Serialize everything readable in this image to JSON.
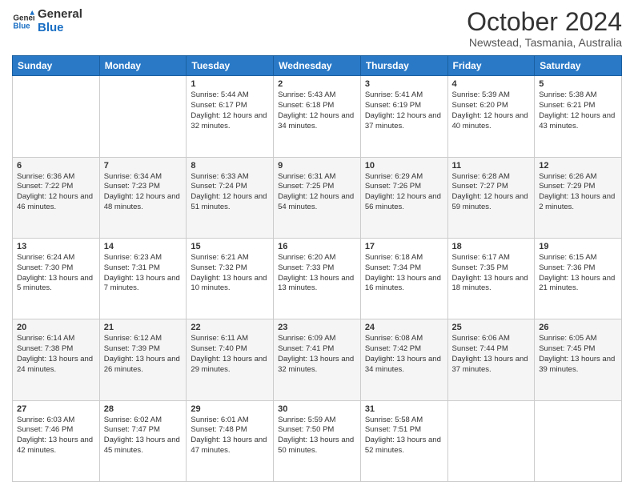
{
  "header": {
    "logo_line1": "General",
    "logo_line2": "Blue",
    "title": "October 2024",
    "subtitle": "Newstead, Tasmania, Australia"
  },
  "weekdays": [
    "Sunday",
    "Monday",
    "Tuesday",
    "Wednesday",
    "Thursday",
    "Friday",
    "Saturday"
  ],
  "weeks": [
    [
      {
        "day": "",
        "info": ""
      },
      {
        "day": "",
        "info": ""
      },
      {
        "day": "1",
        "info": "Sunrise: 5:44 AM\nSunset: 6:17 PM\nDaylight: 12 hours and 32 minutes."
      },
      {
        "day": "2",
        "info": "Sunrise: 5:43 AM\nSunset: 6:18 PM\nDaylight: 12 hours and 34 minutes."
      },
      {
        "day": "3",
        "info": "Sunrise: 5:41 AM\nSunset: 6:19 PM\nDaylight: 12 hours and 37 minutes."
      },
      {
        "day": "4",
        "info": "Sunrise: 5:39 AM\nSunset: 6:20 PM\nDaylight: 12 hours and 40 minutes."
      },
      {
        "day": "5",
        "info": "Sunrise: 5:38 AM\nSunset: 6:21 PM\nDaylight: 12 hours and 43 minutes."
      }
    ],
    [
      {
        "day": "6",
        "info": "Sunrise: 6:36 AM\nSunset: 7:22 PM\nDaylight: 12 hours and 46 minutes."
      },
      {
        "day": "7",
        "info": "Sunrise: 6:34 AM\nSunset: 7:23 PM\nDaylight: 12 hours and 48 minutes."
      },
      {
        "day": "8",
        "info": "Sunrise: 6:33 AM\nSunset: 7:24 PM\nDaylight: 12 hours and 51 minutes."
      },
      {
        "day": "9",
        "info": "Sunrise: 6:31 AM\nSunset: 7:25 PM\nDaylight: 12 hours and 54 minutes."
      },
      {
        "day": "10",
        "info": "Sunrise: 6:29 AM\nSunset: 7:26 PM\nDaylight: 12 hours and 56 minutes."
      },
      {
        "day": "11",
        "info": "Sunrise: 6:28 AM\nSunset: 7:27 PM\nDaylight: 12 hours and 59 minutes."
      },
      {
        "day": "12",
        "info": "Sunrise: 6:26 AM\nSunset: 7:29 PM\nDaylight: 13 hours and 2 minutes."
      }
    ],
    [
      {
        "day": "13",
        "info": "Sunrise: 6:24 AM\nSunset: 7:30 PM\nDaylight: 13 hours and 5 minutes."
      },
      {
        "day": "14",
        "info": "Sunrise: 6:23 AM\nSunset: 7:31 PM\nDaylight: 13 hours and 7 minutes."
      },
      {
        "day": "15",
        "info": "Sunrise: 6:21 AM\nSunset: 7:32 PM\nDaylight: 13 hours and 10 minutes."
      },
      {
        "day": "16",
        "info": "Sunrise: 6:20 AM\nSunset: 7:33 PM\nDaylight: 13 hours and 13 minutes."
      },
      {
        "day": "17",
        "info": "Sunrise: 6:18 AM\nSunset: 7:34 PM\nDaylight: 13 hours and 16 minutes."
      },
      {
        "day": "18",
        "info": "Sunrise: 6:17 AM\nSunset: 7:35 PM\nDaylight: 13 hours and 18 minutes."
      },
      {
        "day": "19",
        "info": "Sunrise: 6:15 AM\nSunset: 7:36 PM\nDaylight: 13 hours and 21 minutes."
      }
    ],
    [
      {
        "day": "20",
        "info": "Sunrise: 6:14 AM\nSunset: 7:38 PM\nDaylight: 13 hours and 24 minutes."
      },
      {
        "day": "21",
        "info": "Sunrise: 6:12 AM\nSunset: 7:39 PM\nDaylight: 13 hours and 26 minutes."
      },
      {
        "day": "22",
        "info": "Sunrise: 6:11 AM\nSunset: 7:40 PM\nDaylight: 13 hours and 29 minutes."
      },
      {
        "day": "23",
        "info": "Sunrise: 6:09 AM\nSunset: 7:41 PM\nDaylight: 13 hours and 32 minutes."
      },
      {
        "day": "24",
        "info": "Sunrise: 6:08 AM\nSunset: 7:42 PM\nDaylight: 13 hours and 34 minutes."
      },
      {
        "day": "25",
        "info": "Sunrise: 6:06 AM\nSunset: 7:44 PM\nDaylight: 13 hours and 37 minutes."
      },
      {
        "day": "26",
        "info": "Sunrise: 6:05 AM\nSunset: 7:45 PM\nDaylight: 13 hours and 39 minutes."
      }
    ],
    [
      {
        "day": "27",
        "info": "Sunrise: 6:03 AM\nSunset: 7:46 PM\nDaylight: 13 hours and 42 minutes."
      },
      {
        "day": "28",
        "info": "Sunrise: 6:02 AM\nSunset: 7:47 PM\nDaylight: 13 hours and 45 minutes."
      },
      {
        "day": "29",
        "info": "Sunrise: 6:01 AM\nSunset: 7:48 PM\nDaylight: 13 hours and 47 minutes."
      },
      {
        "day": "30",
        "info": "Sunrise: 5:59 AM\nSunset: 7:50 PM\nDaylight: 13 hours and 50 minutes."
      },
      {
        "day": "31",
        "info": "Sunrise: 5:58 AM\nSunset: 7:51 PM\nDaylight: 13 hours and 52 minutes."
      },
      {
        "day": "",
        "info": ""
      },
      {
        "day": "",
        "info": ""
      }
    ]
  ]
}
